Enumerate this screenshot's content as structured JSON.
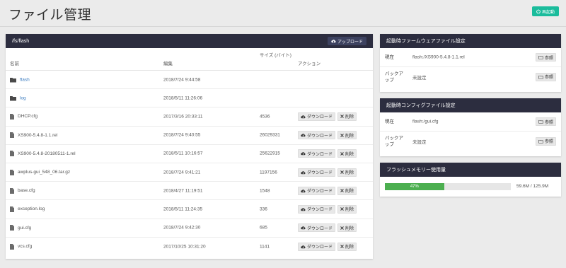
{
  "header": {
    "title": "ファイル管理",
    "restart_label": "再起動"
  },
  "files": {
    "path": "/fs/flash",
    "upload_label": "アップロード",
    "columns": {
      "name": "名前",
      "edited": "編集",
      "size": "サイズ (バイト)",
      "actions": "アクション"
    },
    "download_label": "ダウンロード",
    "delete_label": "削除",
    "rows": [
      {
        "type": "folder",
        "name": "flash",
        "date": "2018/7/24 9:44:58",
        "size": ""
      },
      {
        "type": "folder",
        "name": "log",
        "date": "2018/5/11 11:26:06",
        "size": ""
      },
      {
        "type": "file",
        "name": "DHCP.cfg",
        "date": "2017/3/16 20:33:11",
        "size": "4536"
      },
      {
        "type": "file",
        "name": "XS900-5.4.8-1.1.rel",
        "date": "2018/7/24 9:40:55",
        "size": "26029331"
      },
      {
        "type": "file",
        "name": "XS900-5.4.8-20180511-1.rel",
        "date": "2018/5/11 10:16:57",
        "size": "25622915"
      },
      {
        "type": "file",
        "name": "awplus-gui_548_06.tar.gz",
        "date": "2018/7/24 9:41:21",
        "size": "1197156"
      },
      {
        "type": "file",
        "name": "base.cfg",
        "date": "2018/4/27 11:19:51",
        "size": "1548"
      },
      {
        "type": "file",
        "name": "exception.log",
        "date": "2018/5/11 11:24:35",
        "size": "336"
      },
      {
        "type": "file",
        "name": "gui.cfg",
        "date": "2018/7/24 9:42:30",
        "size": "685"
      },
      {
        "type": "file",
        "name": "vcs.cfg",
        "date": "2017/10/25 10:31:20",
        "size": "1141"
      }
    ]
  },
  "firmware": {
    "title": "起動時ファームウェアファイル設定",
    "current_label": "現在",
    "current_value": "flash:/XS900-5.4.8-1.1.rel",
    "backup_label": "バックアップ",
    "backup_value": "未設定",
    "browse_label": "参照"
  },
  "config": {
    "title": "起動時コンフィグファイル設定",
    "current_label": "現在",
    "current_value": "flash:/gui.cfg",
    "backup_label": "バックアップ",
    "backup_value": "未設定",
    "browse_label": "参照"
  },
  "memory": {
    "title": "フラッシュメモリー使用量",
    "percent_label": "47%",
    "percent": 0.47,
    "usage_text": "59.6M / 125.9M",
    "fill_color": "#4caf50"
  }
}
